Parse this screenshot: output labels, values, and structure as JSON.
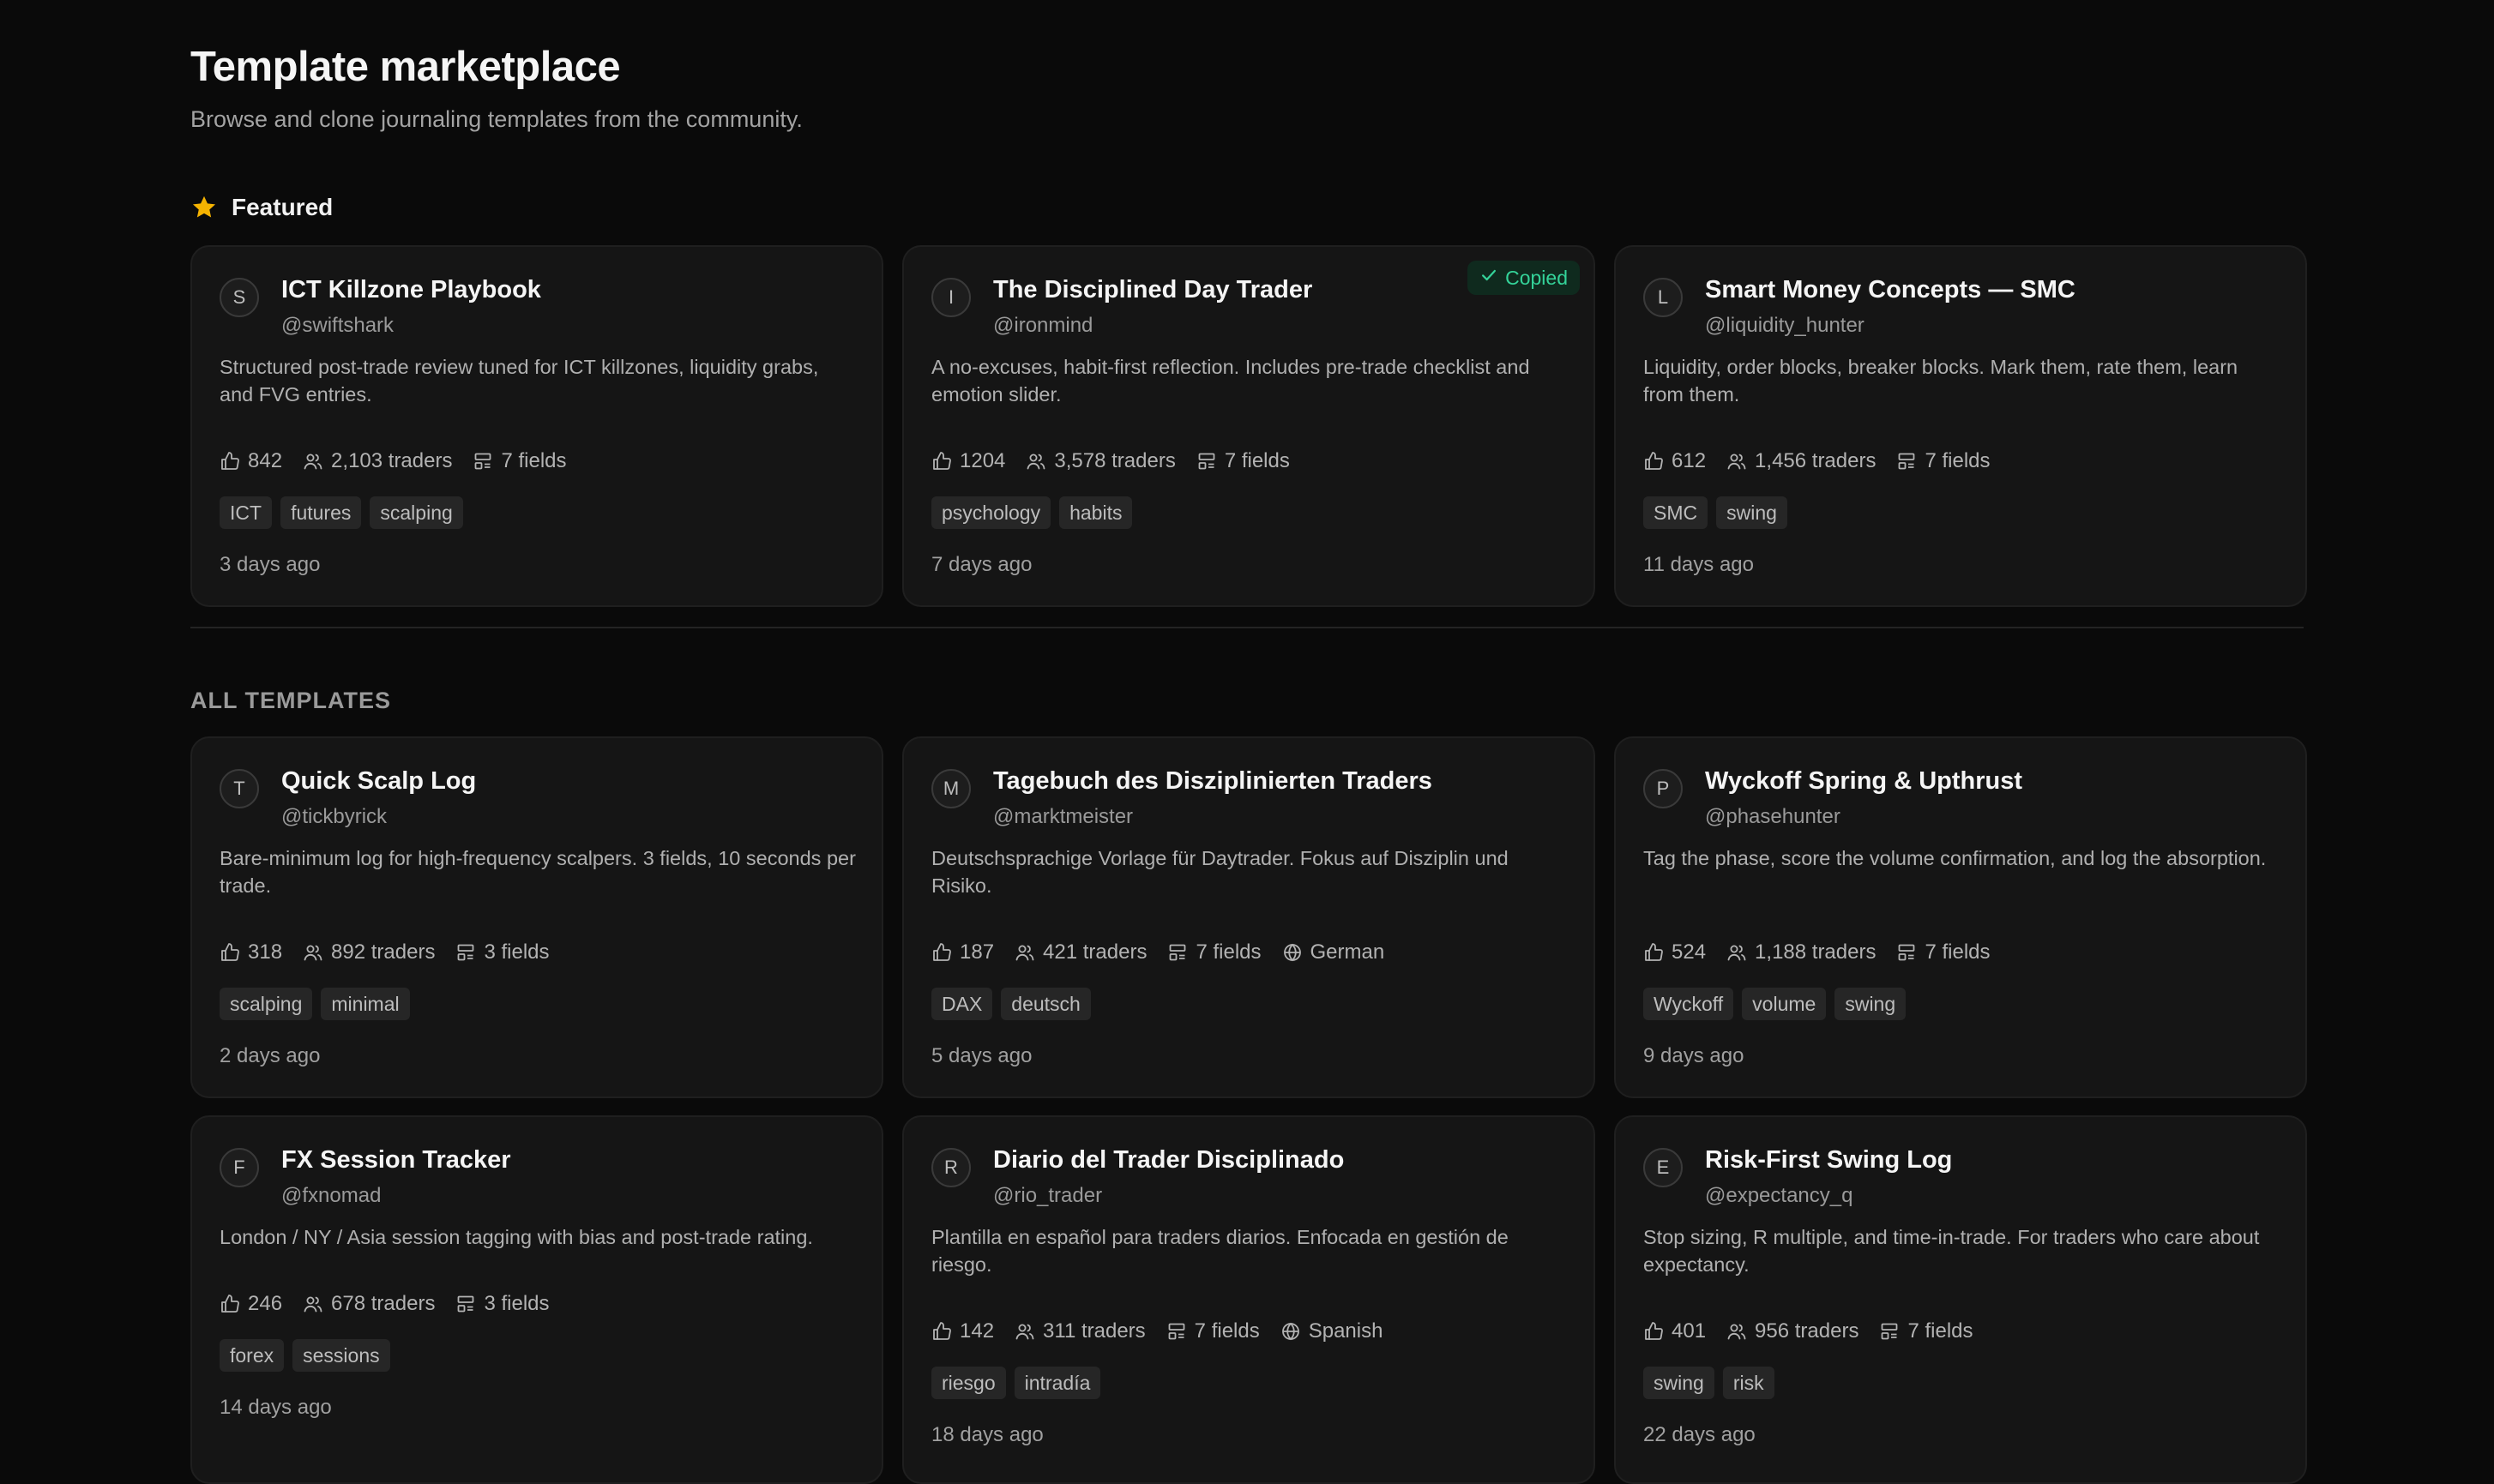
{
  "header": {
    "title": "Template marketplace",
    "subtitle": "Browse and clone journaling templates from the community."
  },
  "featured": {
    "label": "Featured",
    "icon": "star-icon",
    "cards": [
      {
        "initial": "S",
        "title": "ICT Killzone Playbook",
        "handle": "@swiftshark",
        "description": "Structured post-trade review tuned for ICT killzones, liquidity grabs, and FVG entries.",
        "likes": "842",
        "traders": "2,103 traders",
        "fields": "7 fields",
        "language": null,
        "tags": [
          "ICT",
          "futures",
          "scalping"
        ],
        "time": "3 days ago",
        "badge": null
      },
      {
        "initial": "I",
        "title": "The Disciplined Day Trader",
        "handle": "@ironmind",
        "description": "A no-excuses, habit-first reflection. Includes pre-trade checklist and emotion slider.",
        "likes": "1204",
        "traders": "3,578 traders",
        "fields": "7 fields",
        "language": null,
        "tags": [
          "psychology",
          "habits"
        ],
        "time": "7 days ago",
        "badge": "Copied"
      },
      {
        "initial": "L",
        "title": "Smart Money Concepts — SMC",
        "handle": "@liquidity_hunter",
        "description": "Liquidity, order blocks, breaker blocks. Mark them, rate them, learn from them.",
        "likes": "612",
        "traders": "1,456 traders",
        "fields": "7 fields",
        "language": null,
        "tags": [
          "SMC",
          "swing"
        ],
        "time": "11 days ago",
        "badge": null
      }
    ]
  },
  "all_templates": {
    "label": "ALL TEMPLATES",
    "cards": [
      {
        "initial": "T",
        "title": "Quick Scalp Log",
        "handle": "@tickbyrick",
        "description": "Bare-minimum log for high-frequency scalpers. 3 fields, 10 seconds per trade.",
        "likes": "318",
        "traders": "892 traders",
        "fields": "3 fields",
        "language": null,
        "tags": [
          "scalping",
          "minimal"
        ],
        "time": "2 days ago",
        "badge": null
      },
      {
        "initial": "M",
        "title": "Tagebuch des Disziplinierten Traders",
        "handle": "@marktmeister",
        "description": "Deutschsprachige Vorlage für Daytrader. Fokus auf Disziplin und Risiko.",
        "likes": "187",
        "traders": "421 traders",
        "fields": "7 fields",
        "language": "German",
        "tags": [
          "DAX",
          "deutsch"
        ],
        "time": "5 days ago",
        "badge": null
      },
      {
        "initial": "P",
        "title": "Wyckoff Spring & Upthrust",
        "handle": "@phasehunter",
        "description": "Tag the phase, score the volume confirmation, and log the absorption.",
        "likes": "524",
        "traders": "1,188 traders",
        "fields": "7 fields",
        "language": null,
        "tags": [
          "Wyckoff",
          "volume",
          "swing"
        ],
        "time": "9 days ago",
        "badge": null
      },
      {
        "initial": "F",
        "title": "FX Session Tracker",
        "handle": "@fxnomad",
        "description": "London / NY / Asia session tagging with bias and post-trade rating.",
        "likes": "246",
        "traders": "678 traders",
        "fields": "3 fields",
        "language": null,
        "tags": [
          "forex",
          "sessions"
        ],
        "time": "14 days ago",
        "badge": null
      },
      {
        "initial": "R",
        "title": "Diario del Trader Disciplinado",
        "handle": "@rio_trader",
        "description": "Plantilla en español para traders diarios. Enfocada en gestión de riesgo.",
        "likes": "142",
        "traders": "311 traders",
        "fields": "7 fields",
        "language": "Spanish",
        "tags": [
          "riesgo",
          "intradía"
        ],
        "time": "18 days ago",
        "badge": null
      },
      {
        "initial": "E",
        "title": "Risk-First Swing Log",
        "handle": "@expectancy_q",
        "description": "Stop sizing, R multiple, and time-in-trade. For traders who care about expectancy.",
        "likes": "401",
        "traders": "956 traders",
        "fields": "7 fields",
        "language": null,
        "tags": [
          "swing",
          "risk"
        ],
        "time": "22 days ago",
        "badge": null
      }
    ]
  },
  "colors": {
    "background": "#0a0a0a",
    "card": "#151515",
    "accent_star": "#f5b301",
    "copied_green": "#34d399"
  }
}
